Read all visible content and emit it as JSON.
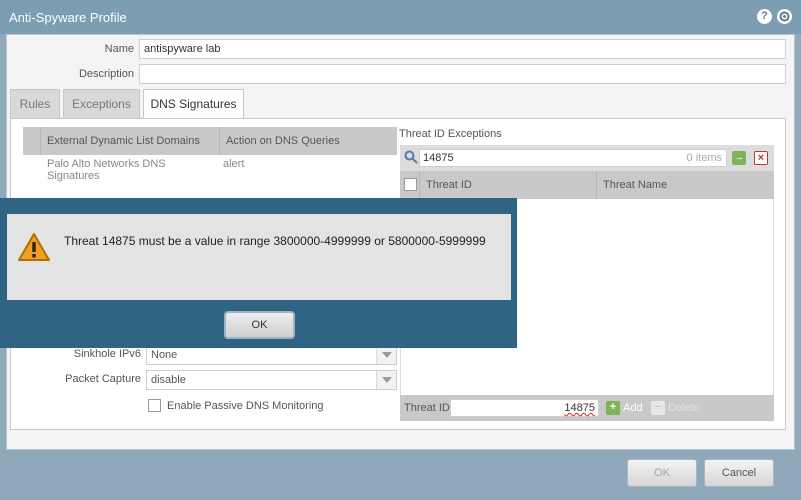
{
  "window": {
    "title": "Anti-Spyware Profile",
    "help_icon": "help-icon",
    "settings_icon": "settings-icon"
  },
  "form": {
    "name_label": "Name",
    "name_value": "antispyware lab",
    "description_label": "Description",
    "description_value": ""
  },
  "tabs": [
    {
      "label": "Rules",
      "active": false
    },
    {
      "label": "Exceptions",
      "active": false
    },
    {
      "label": "DNS Signatures",
      "active": true
    }
  ],
  "dns_table": {
    "columns": [
      "External Dynamic List Domains",
      "Action on DNS Queries"
    ],
    "rows": [
      {
        "domain": "Palo Alto Networks DNS Signatures",
        "action": "alert"
      }
    ]
  },
  "threat_exceptions": {
    "title": "Threat ID Exceptions",
    "search_value": "14875",
    "item_count": "0 items",
    "columns": [
      "Threat ID",
      "Threat Name"
    ],
    "threat_id_label": "Threat ID",
    "threat_id_value": "14875",
    "add_label": "Add",
    "delete_label": "Delete"
  },
  "settings": {
    "sinkhole_ipv6_label": "Sinkhole IPv6",
    "sinkhole_ipv6_value": "None",
    "packet_capture_label": "Packet Capture",
    "packet_capture_value": "disable",
    "passive_dns_label": "Enable Passive DNS Monitoring"
  },
  "alert": {
    "message": "Threat 14875 must be a value in range 3800000-4999999 or 5800000-5999999",
    "ok_label": "OK",
    "icon": "warning-icon"
  },
  "footer": {
    "ok_label": "OK",
    "cancel_label": "Cancel"
  },
  "colors": {
    "titlebar": "#7d9db3",
    "alert_border": "#2f6483",
    "warning": "#f0a020"
  }
}
